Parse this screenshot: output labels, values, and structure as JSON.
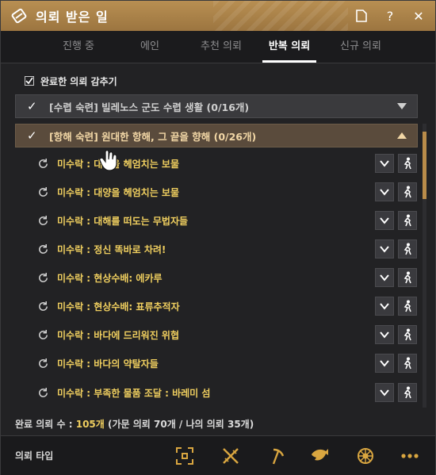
{
  "window": {
    "title": "의뢰 받은 일",
    "buttons": {
      "doc_icon": "document-icon",
      "help": "?",
      "close": "✕"
    }
  },
  "tabs": [
    {
      "label": "진행 중"
    },
    {
      "label": "에인"
    },
    {
      "label": "추천 의뢰"
    },
    {
      "label": "반복 의뢰",
      "active": true
    },
    {
      "label": "신규 의뢰"
    }
  ],
  "hide_completed": {
    "label": "완료한 의뢰 감추기",
    "checked": true
  },
  "groups": [
    {
      "label": "[수렵 숙련] 빌레노스 군도 수렵 생활 (0/16개)",
      "state": "collapsed"
    },
    {
      "label": "[항해 숙련] 원대한 항해, 그 끝을 향해 (0/26개)",
      "state": "expanded"
    }
  ],
  "quests": [
    {
      "label": "미수락 : 대양을 헤엄치는 보물"
    },
    {
      "label": "미수락 : 대양을 헤엄치는 보물"
    },
    {
      "label": "미수락 : 대해를 떠도는 무법자들"
    },
    {
      "label": "미수락 : 정신 똑바로 차려!"
    },
    {
      "label": "미수락 : 현상수배: 에카루"
    },
    {
      "label": "미수락 : 현상수배: 표류추적자"
    },
    {
      "label": "미수락 : 바다에 드리워진 위협"
    },
    {
      "label": "미수락 : 바다의 약탈자들"
    },
    {
      "label": "미수락 : 부족한 물품 조달 : 바레미 섬"
    }
  ],
  "summary": {
    "prefix": "완료 의뢰 수 : ",
    "count": "105개",
    "detail": " (가문 의뢰 70개 / 나의 의뢰 35개)"
  },
  "footer": {
    "label": "의뢰 타입",
    "icons": [
      "target-icon",
      "crossed-swords-icon",
      "pickaxe-icon",
      "fish-icon",
      "ship-wheel-icon",
      "more-icon"
    ]
  },
  "colors": {
    "title_bar": "#b08748",
    "quest_text": "#f0cf5f",
    "accent_gold": "#d9a640"
  }
}
